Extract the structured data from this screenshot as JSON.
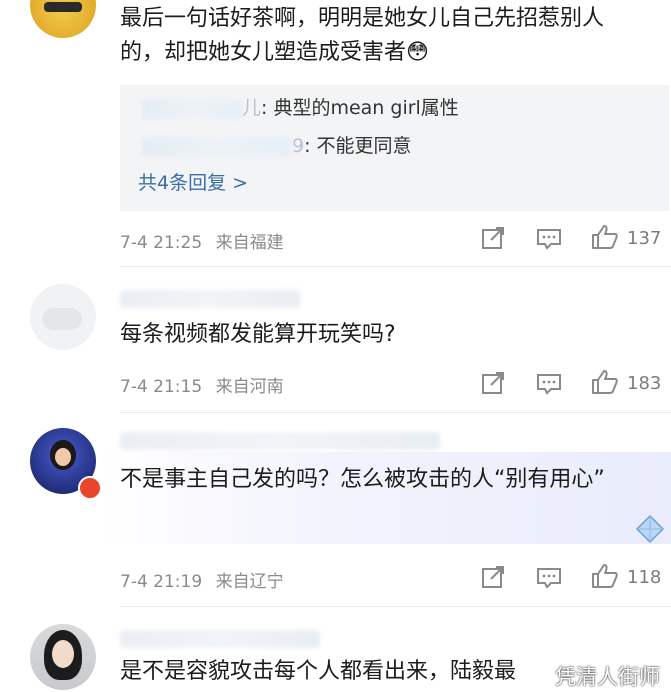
{
  "comments": [
    {
      "text": "最后一句话好茶啊，明明是她女儿自己先招惹别人的，却把她女儿塑造成受害者",
      "emoji": "😳",
      "replies": [
        {
          "name_tail": "儿",
          "text": ": 典型的mean girl属性"
        },
        {
          "name_tail": "9",
          "text": ": 不能更同意"
        }
      ],
      "more_replies": "共4条回复 >",
      "time": "7-4 21:25",
      "location": "来自福建",
      "likes": "137"
    },
    {
      "text": "每条视频都发能算开玩笑吗?",
      "time": "7-4 21:15",
      "location": "来自河南",
      "likes": "183"
    },
    {
      "text": "不是事主自己发的吗？怎么被攻击的人“别有用心”",
      "time": "7-4 21:19",
      "location": "来自辽宁",
      "likes": "118"
    },
    {
      "text": "是不是容貌攻击每个人都看出来，陆毅最"
    }
  ],
  "watermark": "凭清人街师",
  "colors": {
    "link": "#3b6ea8",
    "meta": "#8a8a8a",
    "reply_bg": "#f3f4f6"
  }
}
